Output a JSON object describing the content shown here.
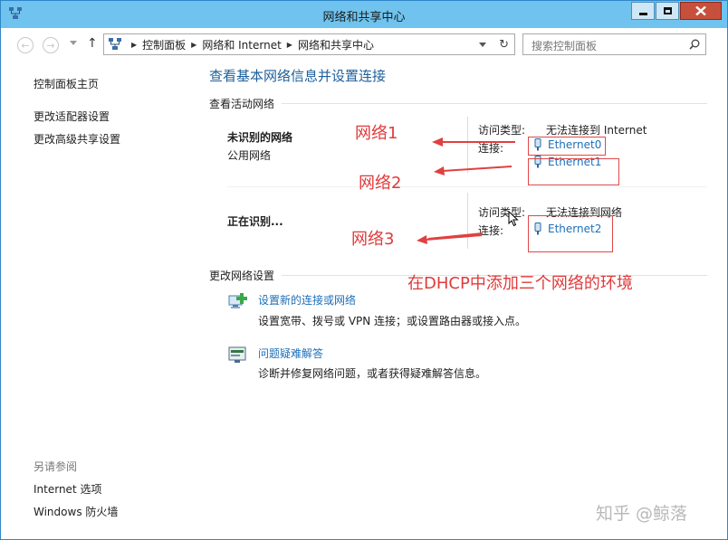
{
  "window": {
    "title": "网络和共享中心"
  },
  "toolbar": {
    "breadcrumbs": [
      "控制面板",
      "网络和 Internet",
      "网络和共享中心"
    ],
    "search_placeholder": "搜索控制面板"
  },
  "sidebar": {
    "links": [
      "控制面板主页",
      "更改适配器设置",
      "更改高级共享设置"
    ],
    "see_also_heading": "另请参阅",
    "see_also_links": [
      "Internet 选项",
      "Windows 防火墙"
    ]
  },
  "main": {
    "title": "查看基本网络信息并设置连接",
    "active_networks_label": "查看活动网络",
    "networks": [
      {
        "name": "未识别的网络",
        "type": "公用网络",
        "access_label": "访问类型:",
        "access_value": "无法连接到 Internet",
        "connections_label": "连接:",
        "connections": [
          "Ethernet0",
          "Ethernet1"
        ]
      },
      {
        "name": "正在识别...",
        "access_label": "访问类型:",
        "access_value": "无法连接到网络",
        "connections_label": "连接:",
        "connections": [
          "Ethernet2"
        ]
      }
    ],
    "change_settings_label": "更改网络设置",
    "tasks": [
      {
        "link": "设置新的连接或网络",
        "desc": "设置宽带、拨号或 VPN 连接；或设置路由器或接入点。"
      },
      {
        "link": "问题疑难解答",
        "desc": "诊断并修复网络问题，或者获得疑难解答信息。"
      }
    ]
  },
  "annotations": {
    "labels": [
      "网络1",
      "网络2",
      "网络3"
    ],
    "caption": "在DHCP中添加三个网络的环境",
    "color": "#e03a3a"
  },
  "watermark": "知乎 @鲸落"
}
